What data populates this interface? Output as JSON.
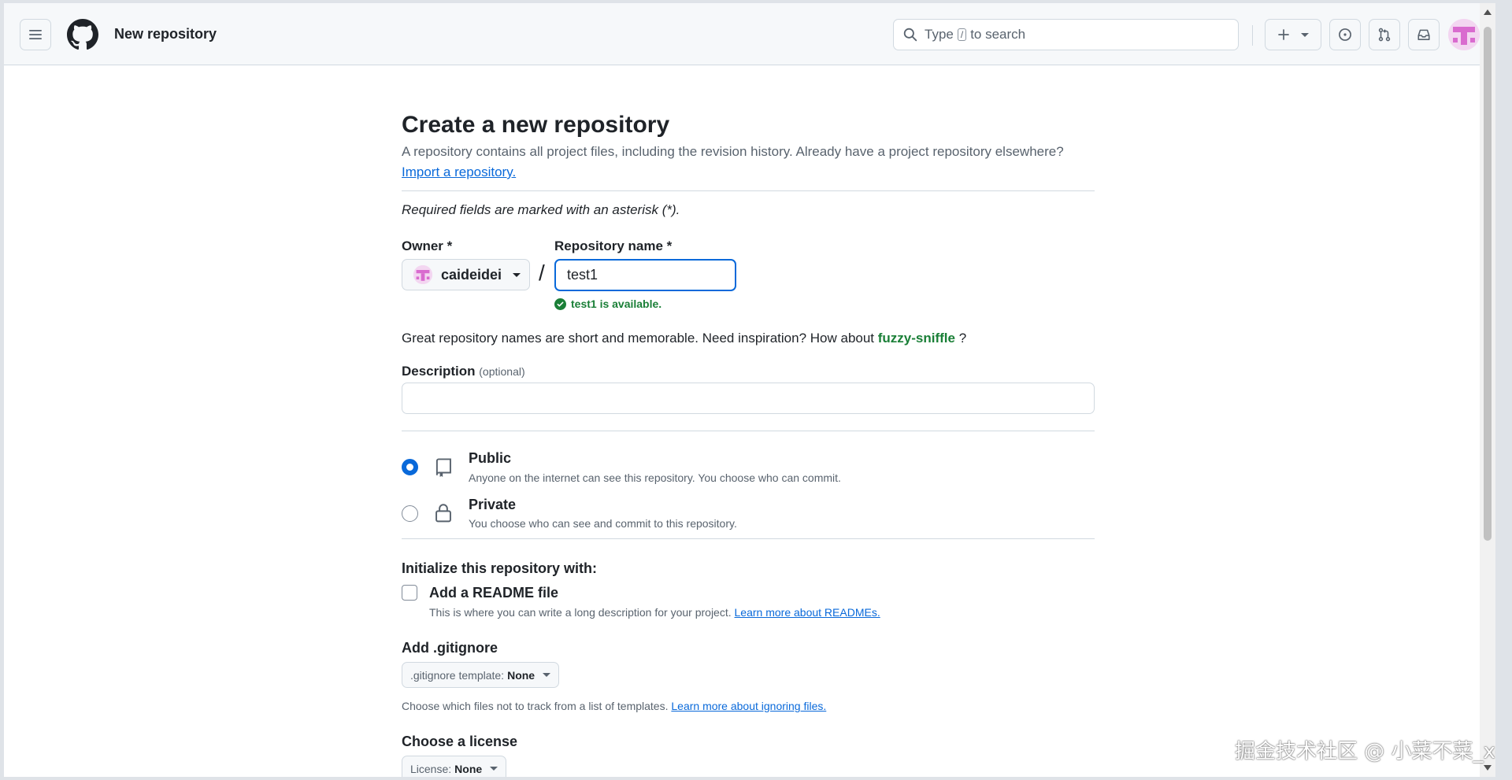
{
  "header": {
    "page_title": "New repository",
    "search_prefix": "Type",
    "search_key": "/",
    "search_suffix": "to search"
  },
  "main": {
    "heading": "Create a new repository",
    "subtitle": "A repository contains all project files, including the revision history. Already have a project repository elsewhere?",
    "import_link": "Import a repository.",
    "required_note": "Required fields are marked with an asterisk (*).",
    "owner_label": "Owner *",
    "owner_value": "caideidei",
    "repo_name_label": "Repository name *",
    "repo_name_value": "test1",
    "availability": "test1 is available.",
    "hint_prefix": "Great repository names are short and memorable. Need inspiration? How about",
    "hint_suggestion": "fuzzy-sniffle",
    "hint_suffix": "?",
    "description_label": "Description",
    "description_optional": "(optional)",
    "description_value": "",
    "visibility": [
      {
        "title": "Public",
        "desc": "Anyone on the internet can see this repository. You choose who can commit.",
        "selected": true
      },
      {
        "title": "Private",
        "desc": "You choose who can see and commit to this repository.",
        "selected": false
      }
    ],
    "init_title": "Initialize this repository with:",
    "readme_label": "Add a README file",
    "readme_checked": false,
    "readme_desc": "This is where you can write a long description for your project.",
    "readme_link": "Learn more about READMEs.",
    "gitignore_title": "Add .gitignore",
    "gitignore_select_prefix": ".gitignore template:",
    "gitignore_select_value": "None",
    "gitignore_desc": "Choose which files not to track from a list of templates.",
    "gitignore_link": "Learn more about ignoring files.",
    "license_title": "Choose a license",
    "license_select_prefix": "License:",
    "license_select_value": "None"
  },
  "watermark": "掘金技术社区 @ 小菜不菜_xc",
  "colors": {
    "accent": "#0969da",
    "success": "#1a7f37",
    "avatar_bg": "#f3d6f1",
    "avatar_fg": "#d96bcf"
  }
}
